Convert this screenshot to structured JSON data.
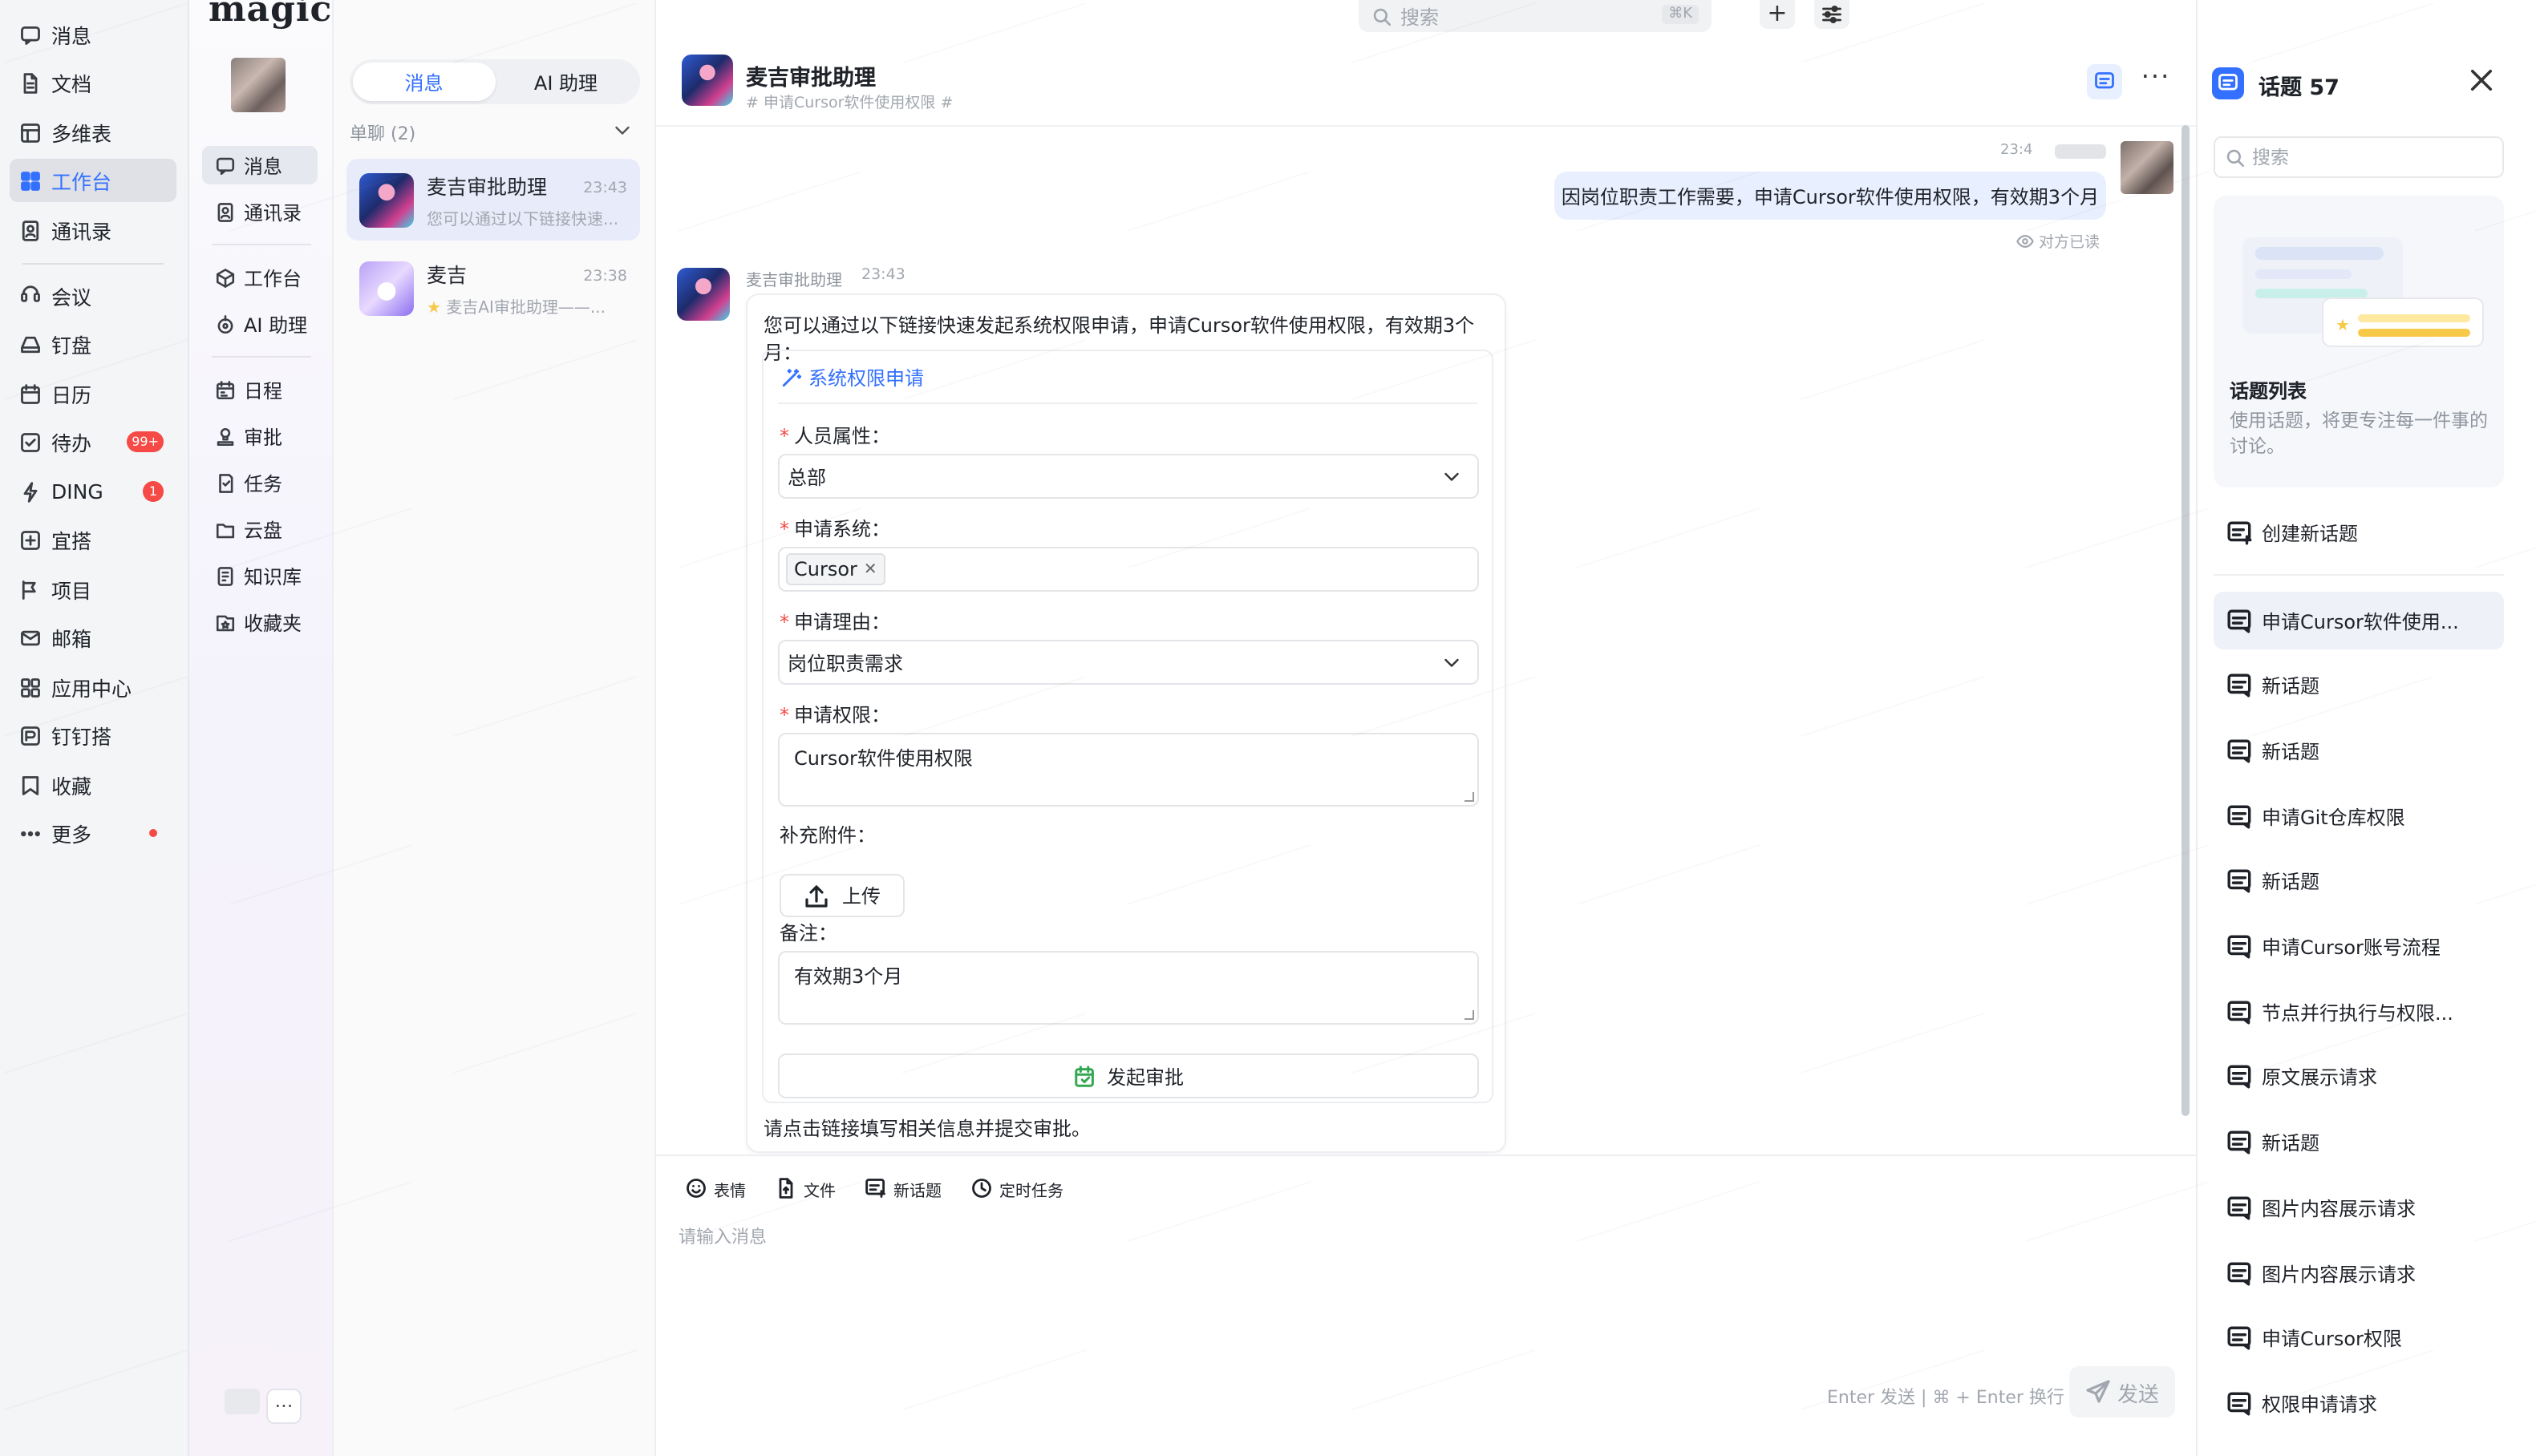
{
  "app": {
    "logo": "magic"
  },
  "global_nav": {
    "items": [
      {
        "label": "消息",
        "icon": "message-icon"
      },
      {
        "label": "文档",
        "icon": "document-icon"
      },
      {
        "label": "多维表",
        "icon": "table-icon"
      },
      {
        "label": "工作台",
        "icon": "grid-icon",
        "active": true
      },
      {
        "label": "通讯录",
        "icon": "contacts-icon"
      },
      {
        "label": "会议",
        "icon": "meeting-icon"
      },
      {
        "label": "钉盘",
        "icon": "drive-icon"
      },
      {
        "label": "日历",
        "icon": "calendar-icon"
      },
      {
        "label": "待办",
        "icon": "todo-icon",
        "badge": "99+"
      },
      {
        "label": "DING",
        "icon": "ding-icon",
        "badge": "1"
      },
      {
        "label": "宜搭",
        "icon": "yida-icon"
      },
      {
        "label": "项目",
        "icon": "project-icon"
      },
      {
        "label": "邮箱",
        "icon": "mail-icon"
      },
      {
        "label": "应用中心",
        "icon": "apps-icon"
      },
      {
        "label": "钉钉搭",
        "icon": "builder-icon"
      },
      {
        "label": "收藏",
        "icon": "favorite-icon"
      },
      {
        "label": "更多",
        "icon": "more-icon",
        "dot": true
      }
    ]
  },
  "sidebar": {
    "items": [
      {
        "label": "消息",
        "icon": "message-icon",
        "active": true
      },
      {
        "label": "通讯录",
        "icon": "contacts-icon"
      },
      {
        "label": "工作台",
        "icon": "cube-icon"
      },
      {
        "label": "AI 助理",
        "icon": "ai-icon"
      },
      {
        "label": "日程",
        "icon": "schedule-icon"
      },
      {
        "label": "审批",
        "icon": "approval-icon"
      },
      {
        "label": "任务",
        "icon": "task-icon"
      },
      {
        "label": "云盘",
        "icon": "folder-icon"
      },
      {
        "label": "知识库",
        "icon": "knowledge-icon"
      },
      {
        "label": "收藏夹",
        "icon": "bookmark-icon"
      }
    ],
    "bottom_more": "···"
  },
  "conv_list": {
    "tabs": [
      {
        "label": "消息"
      },
      {
        "label": "AI 助理"
      }
    ],
    "group_label": "单聊 (2)",
    "items": [
      {
        "name": "麦吉审批助理",
        "time": "23:43",
        "preview": "您可以通过以下链接快速..."
      },
      {
        "name": "麦吉",
        "time": "23:38",
        "preview": "麦吉AI审批助理——..."
      }
    ]
  },
  "top_search": {
    "placeholder": "搜索",
    "shortcut": "⌘K"
  },
  "chat": {
    "title": "麦吉审批助理",
    "subtitle": "# 申请Cursor软件使用权限 #",
    "my_message": {
      "time": "23:4",
      "text": "因岗位职责工作需要，申请Cursor软件使用权限，有效期3个月",
      "status": "对方已读"
    },
    "bot_message": {
      "name": "麦吉审批助理",
      "time": "23:43",
      "intro": "您可以通过以下链接快速发起系统权限申请，申请Cursor软件使用权限，有效期3个月：",
      "outro": "请点击链接填写相关信息并提交审批。"
    },
    "form": {
      "title": "系统权限申请",
      "fields": {
        "person_type": {
          "label": "人员属性：",
          "value": "总部"
        },
        "system": {
          "label": "申请系统：",
          "tag": "Cursor"
        },
        "reason": {
          "label": "申请理由：",
          "value": "岗位职责需求"
        },
        "permission": {
          "label": "申请权限：",
          "value": "Cursor软件使用权限"
        },
        "attachment": {
          "label": "补充附件：",
          "button": "上传"
        },
        "remark": {
          "label": "备注：",
          "value": "有效期3个月"
        }
      },
      "submit": "发起审批"
    },
    "composer": {
      "tools": [
        {
          "label": "表情",
          "icon": "emoji-icon"
        },
        {
          "label": "文件",
          "icon": "file-icon"
        },
        {
          "label": "新话题",
          "icon": "new-topic-icon"
        },
        {
          "label": "定时任务",
          "icon": "timer-icon"
        }
      ],
      "placeholder": "请输入消息",
      "hint": "Enter 发送 | ⌘ + Enter 换行",
      "send": "发送"
    }
  },
  "topics": {
    "title": "话题 57",
    "search_placeholder": "搜索",
    "card": {
      "heading": "话题列表",
      "desc": "使用话题，将更专注每一件事的讨论。"
    },
    "create": "创建新话题",
    "items": [
      "申请Cursor软件使用...",
      "新话题",
      "新话题",
      "申请Git仓库权限",
      "新话题",
      "申请Cursor账号流程",
      "节点并行执行与权限...",
      "原文展示请求",
      "新话题",
      "图片内容展示请求",
      "图片内容展示请求",
      "申请Cursor权限",
      "权限申请请求"
    ]
  }
}
